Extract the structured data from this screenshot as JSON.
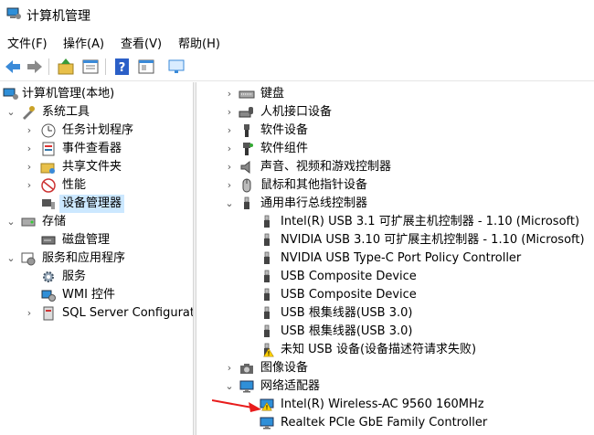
{
  "window": {
    "title": "计算机管理"
  },
  "menu": [
    "文件(F)",
    "操作(A)",
    "查看(V)",
    "帮助(H)"
  ],
  "toolbar_icons": [
    "back-icon",
    "forward-icon",
    "up-folder-icon",
    "show-hide-tree-icon",
    "help-icon",
    "properties-icon",
    "monitor-icon"
  ],
  "left_tree": [
    {
      "label": "计算机管理(本地)",
      "icon": "computer-management-icon"
    },
    {
      "label": "系统工具",
      "icon": "tools-icon"
    },
    {
      "label": "任务计划程序",
      "icon": "clock-icon"
    },
    {
      "label": "事件查看器",
      "icon": "event-viewer-icon"
    },
    {
      "label": "共享文件夹",
      "icon": "shared-folder-icon"
    },
    {
      "label": "性能",
      "icon": "performance-icon"
    },
    {
      "label": "设备管理器",
      "icon": "device-manager-icon"
    },
    {
      "label": "存储",
      "icon": "storage-icon"
    },
    {
      "label": "磁盘管理",
      "icon": "disk-icon"
    },
    {
      "label": "服务和应用程序",
      "icon": "services-apps-icon"
    },
    {
      "label": "服务",
      "icon": "gear-icon"
    },
    {
      "label": "WMI 控件",
      "icon": "wmi-icon"
    },
    {
      "label": "SQL Server Configurati",
      "icon": "sql-server-icon"
    }
  ],
  "device_tree": [
    {
      "label": "键盘",
      "icon": "keyboard-icon"
    },
    {
      "label": "人机接口设备",
      "icon": "hid-icon"
    },
    {
      "label": "软件设备",
      "icon": "software-device-icon"
    },
    {
      "label": "软件组件",
      "icon": "software-component-icon"
    },
    {
      "label": "声音、视频和游戏控制器",
      "icon": "speaker-icon"
    },
    {
      "label": "鼠标和其他指针设备",
      "icon": "mouse-icon"
    },
    {
      "label": "通用串行总线控制器",
      "icon": "usb-icon"
    },
    {
      "label": "Intel(R) USB 3.1 可扩展主机控制器 - 1.10 (Microsoft)",
      "icon": "usb-icon"
    },
    {
      "label": "NVIDIA USB 3.10 可扩展主机控制器 - 1.10 (Microsoft)",
      "icon": "usb-icon"
    },
    {
      "label": "NVIDIA USB Type-C Port Policy Controller",
      "icon": "usb-icon"
    },
    {
      "label": "USB Composite Device",
      "icon": "usb-icon"
    },
    {
      "label": "USB Composite Device",
      "icon": "usb-icon"
    },
    {
      "label": "USB 根集线器(USB 3.0)",
      "icon": "usb-icon"
    },
    {
      "label": "USB 根集线器(USB 3.0)",
      "icon": "usb-icon"
    },
    {
      "label": "未知 USB 设备(设备描述符请求失败)",
      "icon": "usb-warning-icon"
    },
    {
      "label": "图像设备",
      "icon": "camera-icon"
    },
    {
      "label": "网络适配器",
      "icon": "network-adapter-icon"
    },
    {
      "label": "Intel(R) Wireless-AC 9560 160MHz",
      "icon": "network-warning-icon"
    },
    {
      "label": "Realtek PCIe GbE Family Controller",
      "icon": "network-adapter-icon"
    }
  ],
  "annotation_color": "#e81c1c"
}
